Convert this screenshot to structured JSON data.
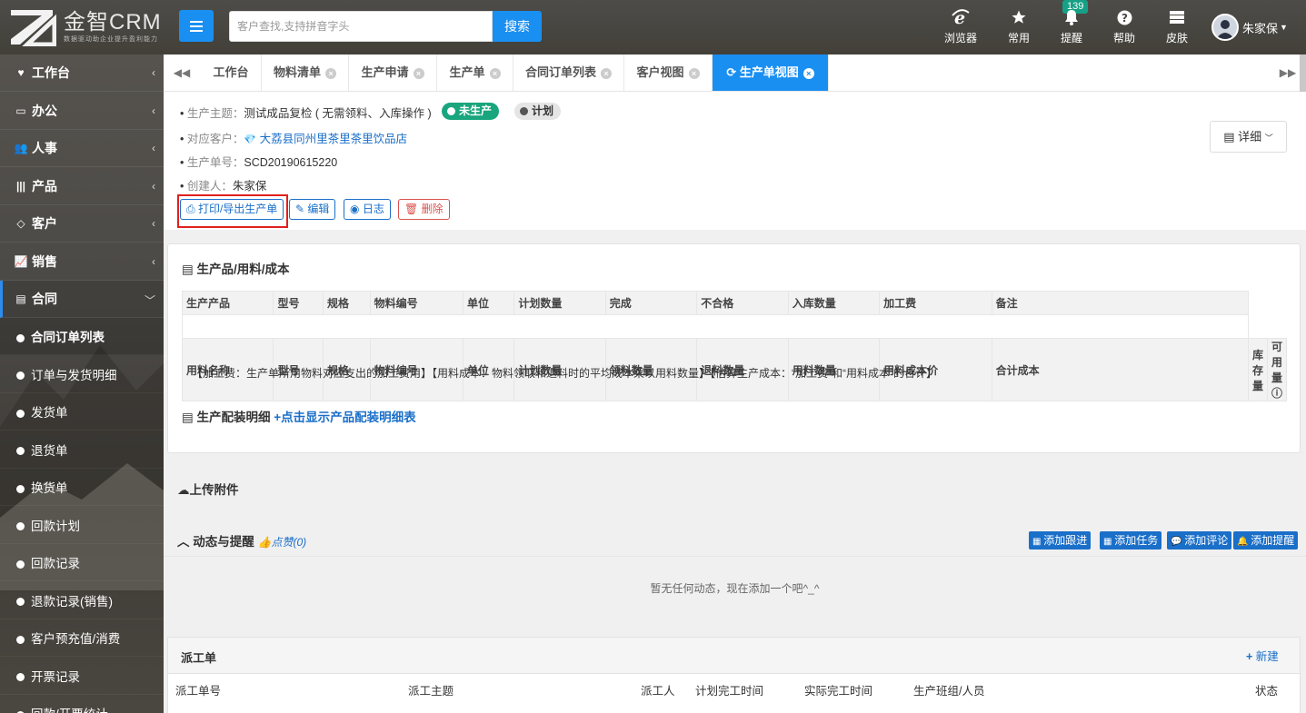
{
  "header": {
    "logo_title": "金智CRM",
    "logo_sub": "数据驱动助企业提升盈利能力",
    "search_placeholder": "客户查找,支持拼音字头",
    "search_button": "搜索",
    "toolbar": [
      {
        "label": "浏览器",
        "icon": "ie-icon"
      },
      {
        "label": "常用",
        "icon": "star-icon"
      },
      {
        "label": "提醒",
        "icon": "bell-icon"
      },
      {
        "label": "帮助",
        "icon": "question-icon"
      },
      {
        "label": "皮肤",
        "icon": "skin-icon"
      }
    ],
    "reminder_count": "139",
    "user_name": "朱家保"
  },
  "sidebar": {
    "items": [
      {
        "label": "工作台",
        "icon": "heart-icon"
      },
      {
        "label": "办公",
        "icon": "laptop-icon"
      },
      {
        "label": "人事",
        "icon": "users-icon"
      },
      {
        "label": "产品",
        "icon": "barcode-icon"
      },
      {
        "label": "客户",
        "icon": "diamond-icon"
      },
      {
        "label": "销售",
        "icon": "chart-line-icon"
      },
      {
        "label": "合同",
        "icon": "list-alt-icon"
      }
    ],
    "sub_items": [
      "合同订单列表",
      "订单与发货明细",
      "发货单",
      "退货单",
      "换货单",
      "回款计划",
      "回款记录",
      "退款记录(销售)",
      "客户预充值/消费",
      "开票记录",
      "回款/开票统计"
    ]
  },
  "tabs": [
    {
      "label": "工作台",
      "closable": false
    },
    {
      "label": "物料清单",
      "closable": true
    },
    {
      "label": "生产申请",
      "closable": true
    },
    {
      "label": "生产单",
      "closable": true
    },
    {
      "label": "合同订单列表",
      "closable": true
    },
    {
      "label": "客户视图",
      "closable": true
    },
    {
      "label": "生产单视图",
      "closable": true,
      "active": true
    }
  ],
  "info": {
    "topic_label": "生产主题：",
    "topic_value": "测试成品复检 ( 无需领料、入库操作 )",
    "status_badge": "未生产",
    "plan_badge": "计划",
    "customer_label": "对应客户：",
    "customer_value": "大荔县同州里茶里茶里饮品店",
    "number_label": "生产单号：",
    "number_value": "SCD20190615220",
    "creator_label": "创建人：",
    "creator_value": "朱家保",
    "detail_button": "详细"
  },
  "actions": {
    "print": "打印/导出生产单",
    "edit": "编辑",
    "log": "日志",
    "delete": "删除"
  },
  "product_section": {
    "title": "生产品/用料/成本",
    "headers1": [
      "生产产品",
      "型号",
      "规格",
      "物料编号",
      "单位",
      "计划数量",
      "完成",
      "不合格",
      "入库数量",
      "加工费",
      "备注"
    ],
    "headers2": [
      "用料名称",
      "型号",
      "规格",
      "物料编号",
      "单位",
      "计划数量",
      "领料数量",
      "退料数量",
      "用料数量",
      "用料成本价",
      "合计成本",
      "库存量",
      "可用量"
    ],
    "note": "【加工费：生产单所用物料对应支出的加工费用】【用料成本：物料领取和退料时的平均成本乘以用料数量】【估算生产成本：“加工费”和“用料成本”的合计】",
    "assembly_title": "生产配装明细",
    "assembly_link": "+点击显示产品配装明细表"
  },
  "attachments": {
    "title": "上传附件"
  },
  "activity": {
    "title": "动态与提醒",
    "like": "点赞(0)",
    "buttons": [
      "添加跟进",
      "添加任务",
      "添加评论",
      "添加提醒"
    ],
    "empty": "暂无任何动态，现在添加一个吧^_^"
  },
  "dispatch": {
    "title": "派工单",
    "new": "新建",
    "headers": [
      "派工单号",
      "派工主题",
      "派工人",
      "计划完工时间",
      "实际完工时间",
      "生产班组/人员",
      "状态"
    ]
  }
}
